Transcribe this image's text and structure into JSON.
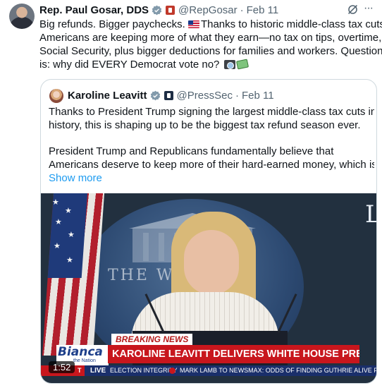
{
  "post": {
    "author_name": "Rep. Paul Gosar, DDS",
    "handle": "@RepGosar",
    "separator": "·",
    "date": "Feb 11",
    "more_label": "···",
    "text_lines": [
      "Big refunds. Bigger paychecks. ",
      "Thanks to historic middle-class tax cuts,",
      "Americans are keeping more of what they earn—no tax on tips, overtime, or",
      "Social Security, plus bigger deductions for families and workers. Question",
      "is: why did EVERY Democrat vote no? "
    ]
  },
  "quoted_post": {
    "author_name": "Karoline Leavitt",
    "handle": "@PressSec",
    "separator": "·",
    "date": "Feb 11",
    "paragraph1_lines": [
      "Thanks to President Trump signing the largest middle-class tax cuts in",
      "history, this is shaping up to be the biggest tax refund season ever."
    ],
    "paragraph2_lines": [
      "President Trump and Republicans fundamentally believe that",
      "Americans deserve to keep more of their hard-earned money, which is ..."
    ],
    "show_more": "Show more"
  },
  "video": {
    "backdrop_text": "THE W    HOUSE",
    "corner_letter": "L",
    "breaking_label": "BREAKING NEWS",
    "headline": "KAROLINE LEAVITT DELIVERS WHITE HOUSE PRESS BRIEFING",
    "logo_main": "Bianca",
    "logo_sub": "the Nation",
    "ticker_t": "T",
    "ticker_live": "LIVE",
    "ticker_item_1": "ELECTION INTEGRITY",
    "ticker_item_2": "MARK LAMB TO NEWSMAX: ODDS OF FINDING GUTHRIE ALIVE FADIN",
    "duration": "1:52"
  },
  "colors": {
    "accent_blue": "#1d9bf0",
    "breaking_red": "#c8161d",
    "ticker_blue": "#1a2f6b"
  },
  "icons": [
    "verified-badge-icon",
    "government-badge-icon",
    "grok-icon",
    "more-icon",
    "us-flag-emoji",
    "camera-emoji",
    "money-emoji"
  ]
}
